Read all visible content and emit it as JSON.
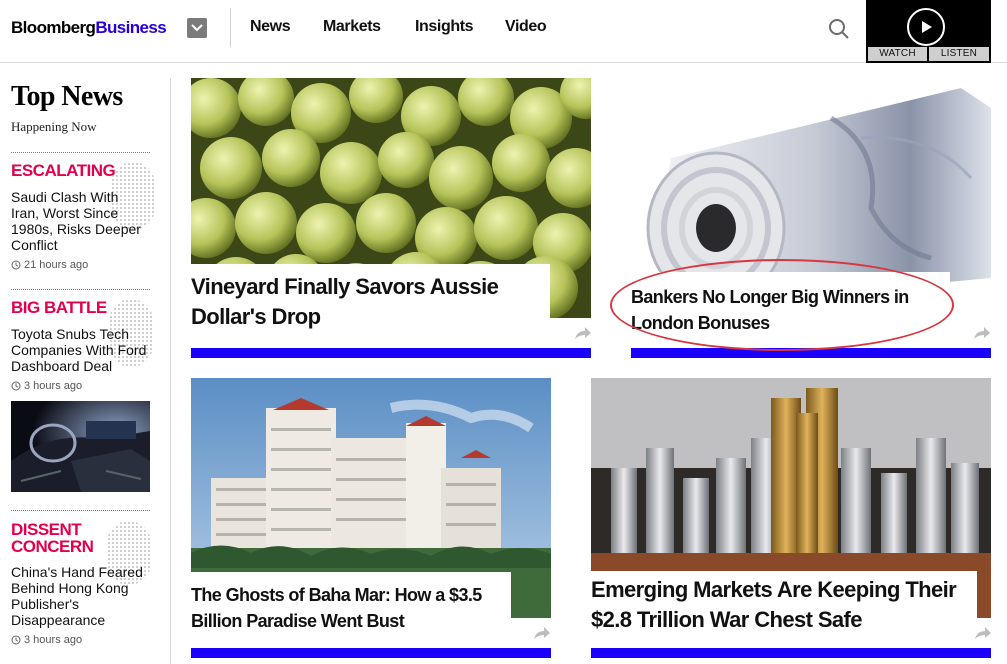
{
  "header": {
    "logo_part1": "Bloomberg",
    "logo_part2": "Business",
    "nav": [
      "News",
      "Markets",
      "Insights",
      "Video"
    ],
    "media": {
      "watch": "WATCH",
      "listen": "LISTEN"
    },
    "icons": {
      "menu": "chevron-down-icon",
      "search": "search-icon",
      "play": "play-icon"
    },
    "colors": {
      "brand_blue": "#2800d7",
      "kicker_red": "#e3004f",
      "bar_blue": "#1a00ff"
    }
  },
  "sidebar": {
    "title": "Top News",
    "subtitle": "Happening Now",
    "items": [
      {
        "kicker_lines": [
          "ESCALATING"
        ],
        "headline": "Saudi Clash With Iran, Worst Since 1980s, Risks Deeper Conflict",
        "time": "21 hours ago"
      },
      {
        "kicker_lines": [
          "BIG BATTLE"
        ],
        "headline": "Toyota Snubs Tech Companies With Ford Dashboard Deal",
        "time": "3 hours ago"
      },
      {
        "kicker_lines": [
          "DISSENT",
          "CONCERN"
        ],
        "headline": "China's Hand Feared Behind Hong Kong Publisher's Disappearance",
        "time": "3 hours ago"
      }
    ]
  },
  "stories": [
    {
      "headline": "Vineyard Finally Savors Aussie Dollar's Drop"
    },
    {
      "headline": "Bankers No Longer Big Winners in London Bonuses"
    },
    {
      "headline": "The Ghosts of Baha Mar: How a $3.5 Billion Paradise Went Bust"
    },
    {
      "headline": "Emerging Markets Are Keeping Their $2.8 Trillion War Chest Safe"
    }
  ]
}
